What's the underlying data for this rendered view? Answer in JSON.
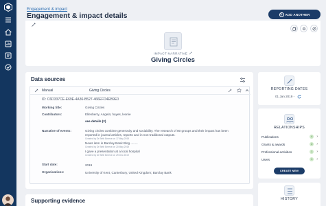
{
  "breadcrumb": "Engagement & impact",
  "page_title": "Engagement & impact details",
  "add_another_label": "ADD ANOTHER",
  "hero": {
    "type_label": "IMPACT NARRATIVE",
    "name": "Giving Circles"
  },
  "data_sources": {
    "title": "Data sources",
    "source_kind": "Manual",
    "source_name": "Giving Circles",
    "id_text": "ID: C6D337CE-E69E-4A36-B527-466EFD4EB9E0",
    "working_title_label": "Working title:",
    "working_title_value": "Giving Circles",
    "contributors_label": "Contributors:",
    "contributors_value": "Ellenberry, Angela; hayes, leonie",
    "see_details": "see details (2)",
    "narrative_label": "Narrative of events:",
    "narrative_text_1": "Giving circles combine generosity and sociability. The research of 80 groups and their impact has been",
    "narrative_text_2": "reported in journal articles, reports and in non-traditional outputs.",
    "narrative_meta_1": "Created by Dr Beth Breeze on 17 May 2019",
    "narrative_item_2": "News item in Barclay Bank Blog ........",
    "narrative_meta_2": "Created by Dr Beth Breeze on 20 May 2019",
    "narrative_item_3": "I gave a presentation at a local hospital",
    "narrative_meta_3": "Created by Dr Beth Breeze on 29 Dec 2019",
    "start_date_label": "Start date:",
    "start_date_value": "2019",
    "organisations_label": "Organisations:",
    "organisations_value": "University of Kent, Canterbury, United Kingdom; Barclay Bank"
  },
  "supporting_evidence_title": "Supporting evidence",
  "reporting_dates": {
    "title": "REPORTING DATES",
    "date": "01 Jan 2019 -"
  },
  "relationships": {
    "title": "RELATIONSHIPS",
    "items": [
      {
        "label": "Publications",
        "count": "4"
      },
      {
        "label": "Grants & awards",
        "count": "2"
      },
      {
        "label": "Professional activities",
        "count": "1"
      },
      {
        "label": "Users",
        "count": "1"
      }
    ],
    "create_label": "CREATE NEW"
  },
  "history_title": "HISTORY",
  "colors": {
    "sidebar": "#13365f",
    "primary_button": "#1c3c68",
    "badge": "#cfe9c9"
  }
}
